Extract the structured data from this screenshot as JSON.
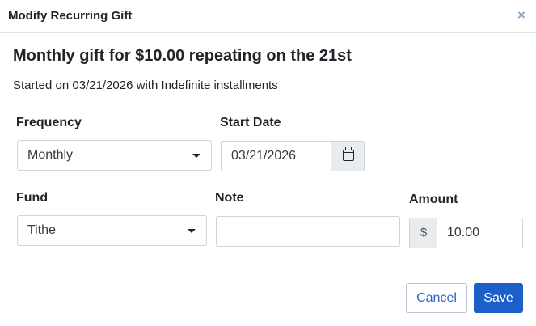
{
  "modal": {
    "title": "Modify Recurring Gift",
    "close_symbol": "×",
    "heading": "Monthly gift for $10.00 repeating on the 21st",
    "subtext": "Started on 03/21/2026 with Indefinite installments"
  },
  "form": {
    "frequency": {
      "label": "Frequency",
      "value": "Monthly"
    },
    "start_date": {
      "label": "Start Date",
      "value": "03/21/2026",
      "icon": "calendar-icon"
    },
    "fund": {
      "label": "Fund",
      "value": "Tithe"
    },
    "note": {
      "label": "Note",
      "value": ""
    },
    "amount": {
      "label": "Amount",
      "prefix": "$",
      "value": "10.00"
    }
  },
  "actions": {
    "cancel_label": "Cancel",
    "save_label": "Save"
  },
  "colors": {
    "primary": "#1c5fc9",
    "close_icon": "#8ea4c8",
    "addon_bg": "#e9ecef"
  }
}
